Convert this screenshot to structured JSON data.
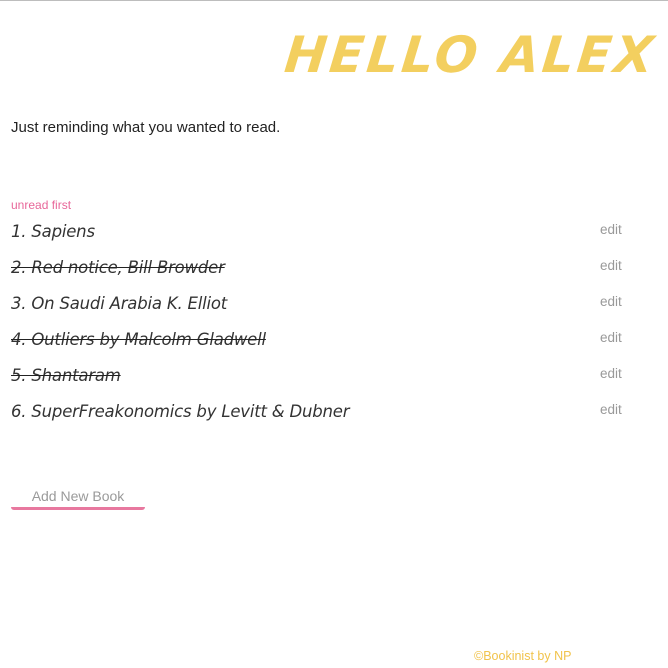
{
  "header": {
    "greeting": "Hello Alex"
  },
  "main": {
    "subtitle": "Just reminding what you wanted to read.",
    "sort_label": "unread first",
    "edit_label": "edit",
    "books": [
      {
        "label": "1. Sapiens",
        "read": false
      },
      {
        "label": "2. Red notice, Bill Browder",
        "read": true
      },
      {
        "label": "3. On Saudi Arabia K. Elliot",
        "read": false
      },
      {
        "label": "4. Outliers by Malcolm Gladwell",
        "read": true
      },
      {
        "label": "5. Shantaram",
        "read": true
      },
      {
        "label": "6. SuperFreakonomics by Levitt & Dubner",
        "read": false
      }
    ],
    "add_button_label": "Add New Book"
  },
  "footer": {
    "text": "©Bookinist by NP"
  },
  "colors": {
    "greeting": "#f3cf5f",
    "accent_pink": "#e8679a",
    "footer": "#f1c34b"
  }
}
